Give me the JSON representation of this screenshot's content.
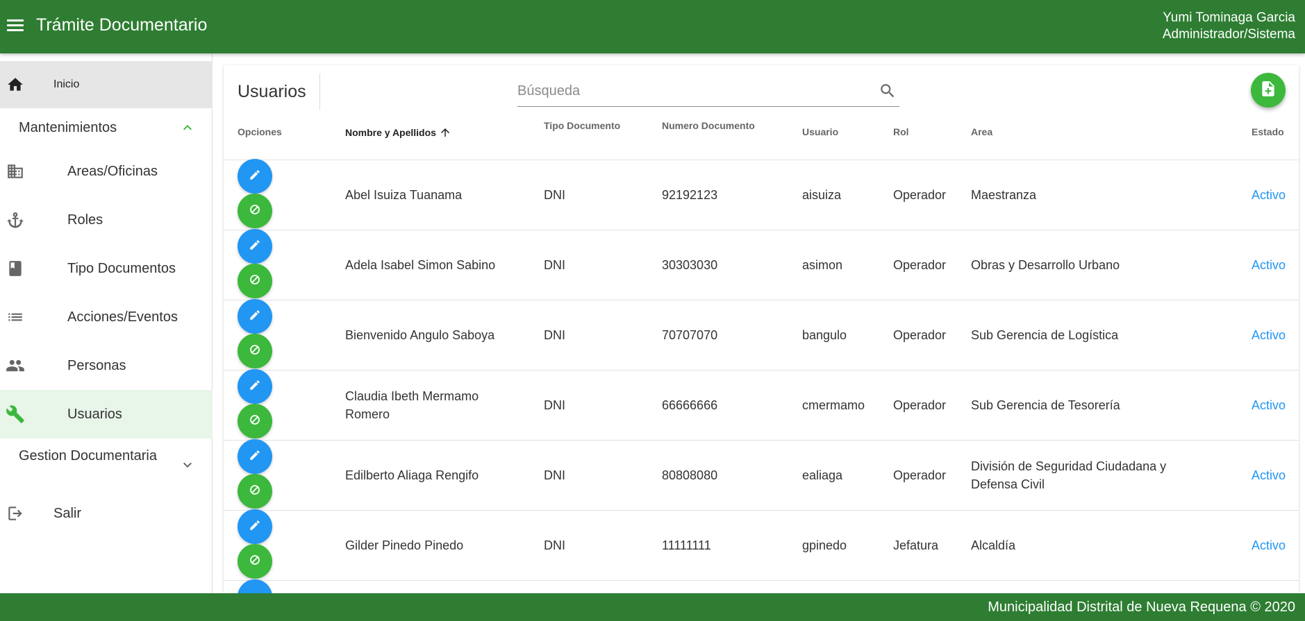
{
  "header": {
    "app_title": "Trámite Documentario",
    "user_name": "Yumi Tominaga Garcia",
    "user_role": "Administrador/Sistema"
  },
  "sidebar": {
    "home_label": "Inicio",
    "section_mantenimientos": "Mantenimientos",
    "items": [
      {
        "label": "Areas/Oficinas",
        "icon": "building-icon"
      },
      {
        "label": "Roles",
        "icon": "anchor-icon"
      },
      {
        "label": "Tipo Documentos",
        "icon": "book-icon"
      },
      {
        "label": "Acciones/Eventos",
        "icon": "list-icon"
      },
      {
        "label": "Personas",
        "icon": "people-icon"
      },
      {
        "label": "Usuarios",
        "icon": "wrench-icon",
        "active": true
      }
    ],
    "section_gestion": "Gestion Documentaria",
    "logout_label": "Salir"
  },
  "main": {
    "title": "Usuarios",
    "search_placeholder": "Búsqueda",
    "columns": {
      "opciones": "Opciones",
      "nombre": "Nombre y Apellidos",
      "tipo_doc": "Tipo Documento",
      "num_doc": "Numero Documento",
      "usuario": "Usuario",
      "rol": "Rol",
      "area": "Area",
      "estado": "Estado"
    },
    "sorted_column": "Nombre y Apellidos",
    "rows": [
      {
        "nombre": "Abel Isuiza Tuanama",
        "tipo_doc": "DNI",
        "num_doc": "92192123",
        "usuario": "aisuiza",
        "rol": "Operador",
        "area": "Maestranza",
        "estado": "Activo"
      },
      {
        "nombre": "Adela Isabel Simon Sabino",
        "tipo_doc": "DNI",
        "num_doc": "30303030",
        "usuario": "asimon",
        "rol": "Operador",
        "area": "Obras y Desarrollo Urbano",
        "estado": "Activo"
      },
      {
        "nombre": "Bienvenido Angulo Saboya",
        "tipo_doc": "DNI",
        "num_doc": "70707070",
        "usuario": "bangulo",
        "rol": "Operador",
        "area": "Sub Gerencia de Logística",
        "estado": "Activo"
      },
      {
        "nombre": "Claudia Ibeth Mermamo Romero",
        "tipo_doc": "DNI",
        "num_doc": "66666666",
        "usuario": "cmermamo",
        "rol": "Operador",
        "area": "Sub Gerencia de Tesorería",
        "estado": "Activo"
      },
      {
        "nombre": "Edilberto Aliaga Rengifo",
        "tipo_doc": "DNI",
        "num_doc": "80808080",
        "usuario": "ealiaga",
        "rol": "Operador",
        "area": "División de Seguridad Ciudadana y Defensa Civil",
        "estado": "Activo"
      },
      {
        "nombre": "Gilder Pinedo Pinedo",
        "tipo_doc": "DNI",
        "num_doc": "11111111",
        "usuario": "gpinedo",
        "rol": "Jefatura",
        "area": "Alcaldía",
        "estado": "Activo"
      }
    ]
  },
  "footer": {
    "text": "Municipalidad Distrital de Nueva Requena © 2020"
  },
  "colors": {
    "primary": "#2e7d32",
    "accent_green": "#3cb83c",
    "edit_blue": "#2196f3",
    "status_blue": "#2196f3"
  }
}
